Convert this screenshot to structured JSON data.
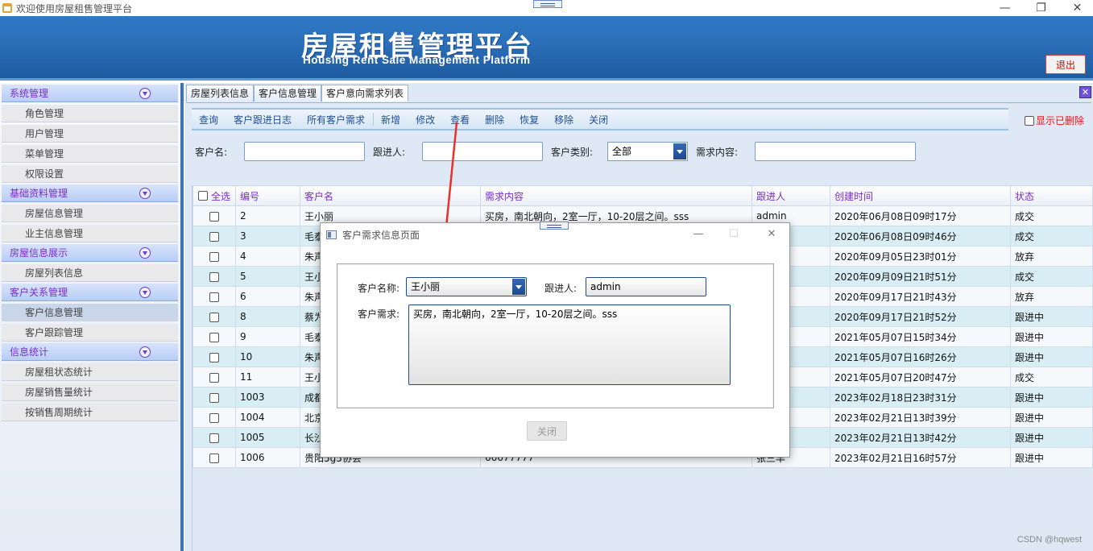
{
  "window": {
    "title": "欢迎使用房屋租售管理平台",
    "minimize": "—",
    "maximize": "❐",
    "close": "✕"
  },
  "banner": {
    "title_cn": "房屋租售管理平台",
    "title_en": "Housing Rent Sale Management Platform",
    "logout_label": "退出"
  },
  "sidebar": {
    "groups": [
      {
        "label": "系统管理",
        "items": [
          "角色管理",
          "用户管理",
          "菜单管理",
          "权限设置"
        ]
      },
      {
        "label": "基础资料管理",
        "items": [
          "房屋信息管理",
          "业主信息管理"
        ]
      },
      {
        "label": "房屋信息展示",
        "items": [
          "房屋列表信息"
        ]
      },
      {
        "label": "客户关系管理",
        "items": [
          "客户信息管理",
          "客户跟踪管理"
        ]
      },
      {
        "label": "信息统计",
        "items": [
          "房屋租状态统计",
          "房屋销售量统计",
          "按销售周期统计"
        ]
      }
    ]
  },
  "tabs": [
    "房屋列表信息",
    "客户信息管理",
    "客户意向需求列表"
  ],
  "tab_close": "✕",
  "toolbar": {
    "group1": [
      "查询",
      "客户跟进日志",
      "所有客户需求"
    ],
    "group2": [
      "新增",
      "修改",
      "查看",
      "删除",
      "恢复",
      "移除",
      "关闭"
    ],
    "show_deleted": "显示已删除"
  },
  "filters": {
    "customer_name_label": "客户名:",
    "follower_label": "跟进人:",
    "customer_type_label": "客户类别:",
    "customer_type_value": "全部",
    "demand_label": "需求内容:"
  },
  "table": {
    "select_all": "全选",
    "columns": [
      "编号",
      "客户名",
      "需求内容",
      "跟进人",
      "创建时间",
      "状态"
    ],
    "rows": [
      [
        "2",
        "王小丽",
        "买房，南北朝向，2室一厅，10-20层之间。sss",
        "admin",
        "2020年06月08日09时17分",
        "成交"
      ],
      [
        "3",
        "毛泰",
        "",
        "",
        "2020年06月08日09时46分",
        "成交"
      ],
      [
        "4",
        "朱声",
        "",
        "",
        "2020年09月05日23时01分",
        "放弃"
      ],
      [
        "5",
        "王小",
        "",
        "",
        "2020年09月09日21时51分",
        "成交"
      ],
      [
        "6",
        "朱声",
        "",
        "",
        "2020年09月17日21时43分",
        "放弃"
      ],
      [
        "8",
        "蔡为",
        "",
        "",
        "2020年09月17日21时52分",
        "跟进中"
      ],
      [
        "9",
        "毛泰",
        "",
        "",
        "2021年05月07日15时34分",
        "跟进中"
      ],
      [
        "10",
        "朱声",
        "",
        "",
        "2021年05月07日16时26分",
        "跟进中"
      ],
      [
        "11",
        "王小",
        "",
        "",
        "2021年05月07日20时47分",
        "成交"
      ],
      [
        "1003",
        "成都",
        "",
        "",
        "2023年02月18日23时31分",
        "跟进中"
      ],
      [
        "1004",
        "北京",
        "",
        "",
        "2023年02月21日13时39分",
        "跟进中"
      ],
      [
        "1005",
        "长沙",
        "",
        "",
        "2023年02月21日13时42分",
        "跟进中"
      ],
      [
        "1006",
        "贵阳5g5协会",
        "66677777",
        "张三丰",
        "2023年02月21日16时57分",
        "跟进中"
      ]
    ]
  },
  "dialog": {
    "title": "客户需求信息页面",
    "minimize": "—",
    "maximize": "☐",
    "close": "✕",
    "customer_name_label": "客户名称:",
    "customer_name_value": "王小丽",
    "follower_label": "跟进人:",
    "follower_value": "admin",
    "demand_label": "客户需求:",
    "demand_value": "买房，南北朝向，2室一厅，10-20层之间。sss",
    "close_button": "关闭"
  },
  "watermark": "CSDN @hqwest",
  "colors": {
    "banner": "#2a6fb8",
    "menu_header_text": "#7a2ec9",
    "toolbar_text": "#1f4f93",
    "alert_red": "#ee1111",
    "arrow_red": "#e8312a"
  }
}
